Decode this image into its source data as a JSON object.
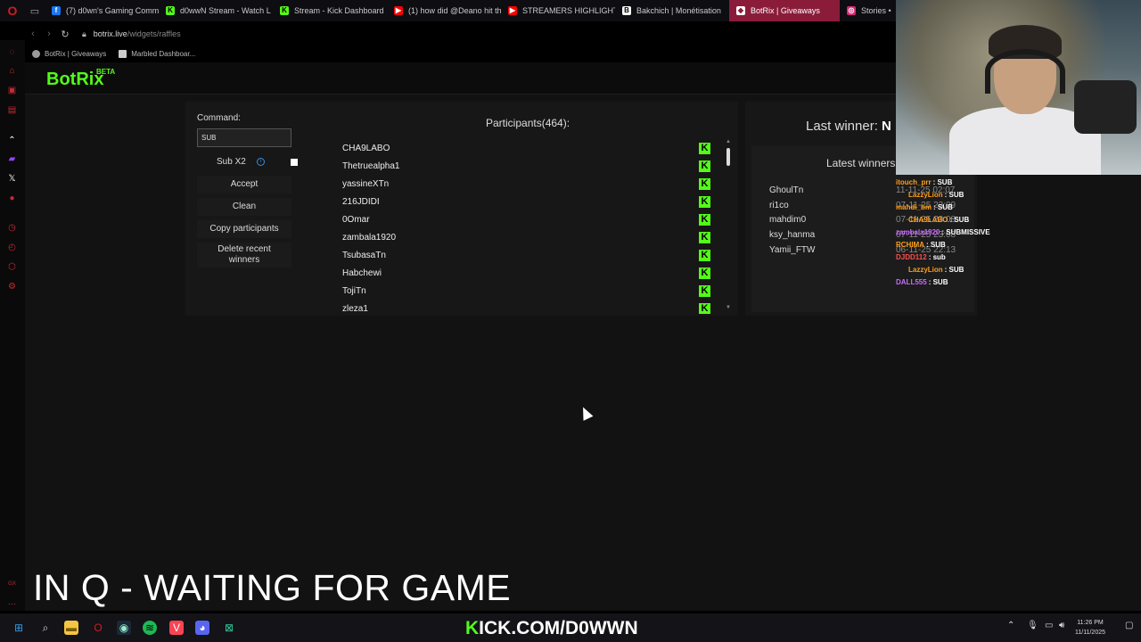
{
  "browser": {
    "tabs": [
      {
        "label": "(7) d0wn's Gaming Comm",
        "fav_color": "#1877f2",
        "fav_text": "f"
      },
      {
        "label": "d0wwN Stream - Watch L",
        "fav_color": "#53fc18",
        "fav_text": "K"
      },
      {
        "label": "Stream - Kick Dashboard",
        "fav_color": "#53fc18",
        "fav_text": "K"
      },
      {
        "label": "(1) how did @Deano hit th",
        "fav_color": "#ff0000",
        "fav_text": "▶"
      },
      {
        "label": "STREAMERS HIGHLIGHT",
        "fav_color": "#ff0000",
        "fav_text": "▶"
      },
      {
        "label": "Bakchich | Monétisation",
        "fav_color": "#ffffff",
        "fav_text": "B"
      },
      {
        "label": "BotRix | Giveaways",
        "fav_color": "#ffffff",
        "fav_text": "◆"
      },
      {
        "label": "Stories •",
        "fav_color": "#d62976",
        "fav_text": "◎"
      }
    ],
    "url_host": "botrix.live",
    "url_path": "/widgets/raffles",
    "bookmarks": [
      "BotRix | Giveaways",
      "Marbled Dashboar..."
    ]
  },
  "app": {
    "logo": "BotRix",
    "logo_badge": "BETA"
  },
  "controls": {
    "command_label": "Command:",
    "command_value": "SUB",
    "subx2_label": "Sub X2",
    "accept": "Accept",
    "clean": "Clean",
    "copy_participants": "Copy participants",
    "delete_recent_winners": "Delete recent winners"
  },
  "participants": {
    "title": "Participants(464):",
    "list": [
      "CHA9LABO",
      "Thetruealpha1",
      "yassineXTn",
      "216JDIDI",
      "0Omar",
      "zambala1920",
      "TsubasaTn",
      "Habchewi",
      "TojiTn",
      "zleza1"
    ]
  },
  "winners": {
    "last_winner_label": "Last winner:",
    "last_winner_value": "N",
    "latest_title": "Latest winners",
    "list": [
      {
        "name": "GhoulTn",
        "date": "11-11-25 02:07"
      },
      {
        "name": "ri1co",
        "date": "07-11-25 23:09"
      },
      {
        "name": "mahdim0",
        "date": "07-11-25 23:08"
      },
      {
        "name": "ksy_hanma",
        "date": "07-11-25 23:08"
      },
      {
        "name": "Yamii_FTW",
        "date": "06-11-25 22:13"
      }
    ]
  },
  "chat": [
    {
      "user": "itouch_prr",
      "msg": ": SUB",
      "color": "#ff9f1a"
    },
    {
      "user": "LazzyLion",
      "msg": ": SUB",
      "color": "#ff9f1a"
    },
    {
      "user": "mahdi_bm",
      "msg": ": SUB",
      "color": "#ff9f1a"
    },
    {
      "user": "CHA9LABO",
      "msg": ": SUB",
      "color": "#ff9f1a"
    },
    {
      "user": "zambala1920",
      "msg": ": SUBMISSIVE",
      "color": "#c86bff"
    },
    {
      "user": "RCHIMA",
      "msg": ": SUB",
      "color": "#ff9f1a"
    },
    {
      "user": "DJDD112",
      "msg": ": sub",
      "color": "#ff4d4d"
    },
    {
      "user": "LazzyLion",
      "msg": ": SUB",
      "color": "#ff9f1a"
    },
    {
      "user": "DALL555",
      "msg": ": SUB",
      "color": "#c86bff"
    }
  ],
  "stream_overlay": {
    "status_text": "IN Q - WAITING FOR GAME",
    "kick_k": "K",
    "kick_rest": "ICK.COM/D0WWN"
  },
  "taskbar": {
    "time": "11:26 PM",
    "date": "11/11/2025"
  },
  "colors": {
    "kick_green": "#53fc18",
    "active_tab": "#8a1c3a",
    "panel_bg": "#171717"
  }
}
